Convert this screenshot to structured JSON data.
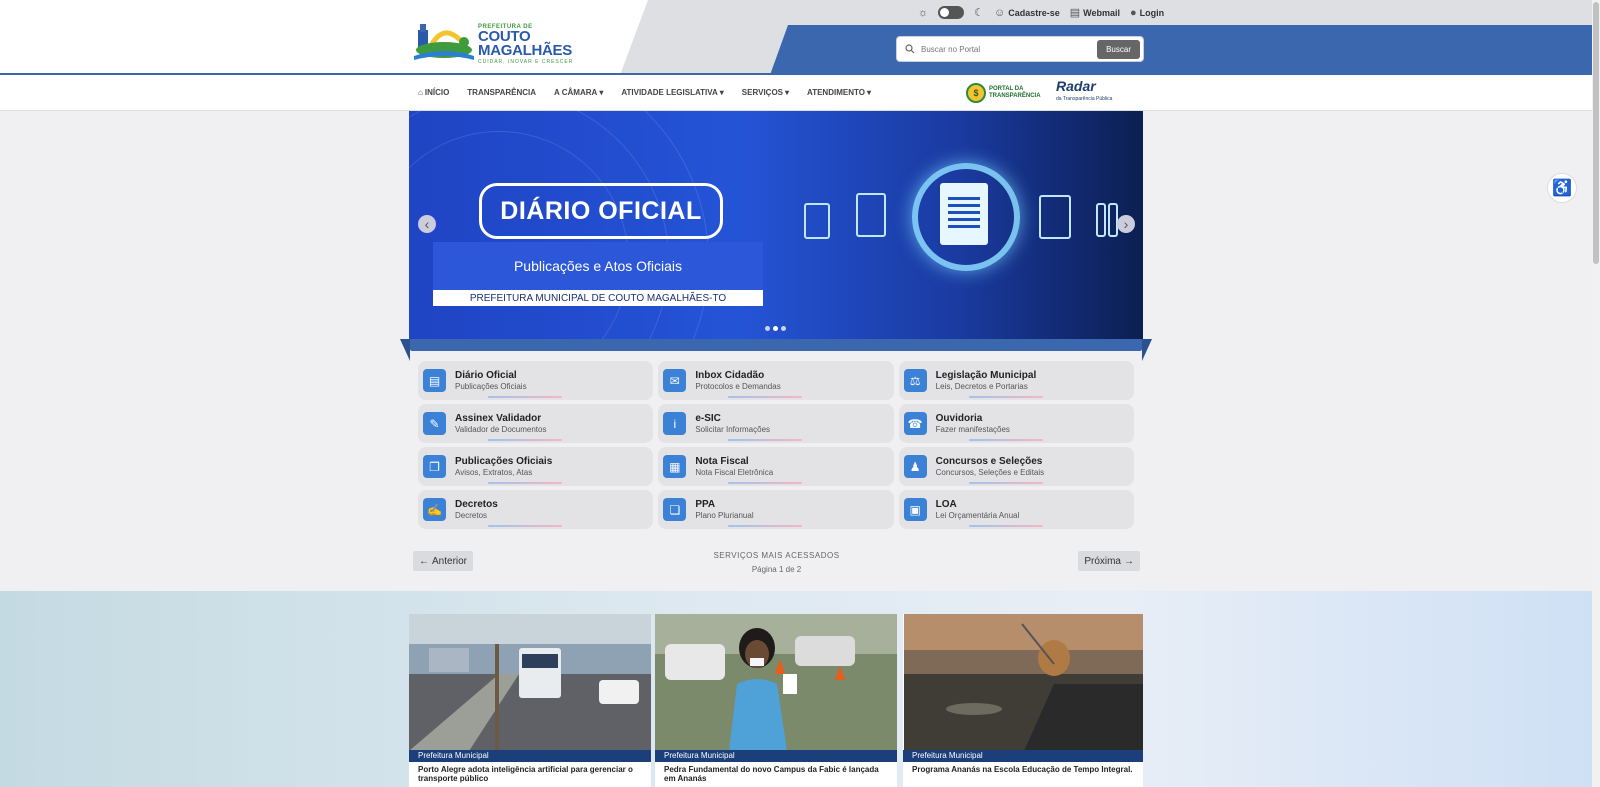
{
  "header": {
    "logo": {
      "prefix": "PREFEITURA DE",
      "name_line1": "COUTO",
      "name_line2": "MAGALHÃES",
      "tagline": "CUIDAR, INOVAR E CRESCER"
    },
    "topbar": {
      "cadastre": "Cadastre-se",
      "webmail": "Webmail",
      "login": "Login"
    },
    "search": {
      "placeholder": "Buscar no Portal",
      "button": "Buscar"
    }
  },
  "nav": {
    "items": [
      "INÍCIO",
      "TRANSPARÊNCIA",
      "A CÂMARA",
      "ATIVIDADE LEGISLATIVA",
      "SERVIÇOS",
      "ATENDIMENTO"
    ],
    "portal": {
      "line1": "PORTAL DA",
      "line2": "TRANSPARÊNCIA"
    },
    "radar": {
      "title": "Radar",
      "subtitle": "da Transparência Pública"
    }
  },
  "banner": {
    "title": "DIÁRIO OFICIAL",
    "subtitle": "Publicações e Atos Oficiais",
    "footer": "PREFEITURA MUNICIPAL DE COUTO MAGALHÃES-TO"
  },
  "services": [
    {
      "title": "Diário Oficial",
      "subtitle": "Publicações Oficiais",
      "icon": "newspaper-icon",
      "glyph": "▤"
    },
    {
      "title": "Inbox Cidadão",
      "subtitle": "Protocolos e Demandas",
      "icon": "inbox-icon",
      "glyph": "✉"
    },
    {
      "title": "Legislação Municipal",
      "subtitle": "Leis, Decretos e Portarias",
      "icon": "scale-icon",
      "glyph": "⚖"
    },
    {
      "title": "Assinex Validador",
      "subtitle": "Validador de Documentos",
      "icon": "signature-icon",
      "glyph": "✎"
    },
    {
      "title": "e-SIC",
      "subtitle": "Solicitar Informações",
      "icon": "info-icon",
      "glyph": "i"
    },
    {
      "title": "Ouvidoria",
      "subtitle": "Fazer manifestações",
      "icon": "phone-icon",
      "glyph": "☎"
    },
    {
      "title": "Publicações Oficiais",
      "subtitle": "Avisos, Extratos, Atas",
      "icon": "documents-icon",
      "glyph": "❐"
    },
    {
      "title": "Nota Fiscal",
      "subtitle": "Nota Fiscal Eletrônica",
      "icon": "cash-register-icon",
      "glyph": "▦"
    },
    {
      "title": "Concursos e Seleções",
      "subtitle": "Concursos, Seleções e Editais",
      "icon": "user-tie-icon",
      "glyph": "♟"
    },
    {
      "title": "Decretos",
      "subtitle": "Decretos",
      "icon": "document-edit-icon",
      "glyph": "✍"
    },
    {
      "title": "PPA",
      "subtitle": "Plano Plurianual",
      "icon": "file-chart-icon",
      "glyph": "❏"
    },
    {
      "title": "LOA",
      "subtitle": "Lei Orçamentária Anual",
      "icon": "file-icon",
      "glyph": "▣"
    }
  ],
  "pager": {
    "prev": "Anterior",
    "next": "Próxima",
    "title": "SERVIÇOS MAIS ACESSADOS",
    "page": "Página 1 de 2"
  },
  "news": [
    {
      "category": "Prefeitura Municipal",
      "title": "Porto Alegre adota inteligência artificial para gerenciar o transporte público"
    },
    {
      "category": "Prefeitura Municipal",
      "title": "Pedra Fundamental do novo Campus da Fabic é lançada em Ananás"
    },
    {
      "category": "Prefeitura Municipal",
      "title": "Programa Ananás na Escola Educação de Tempo Integral."
    }
  ]
}
